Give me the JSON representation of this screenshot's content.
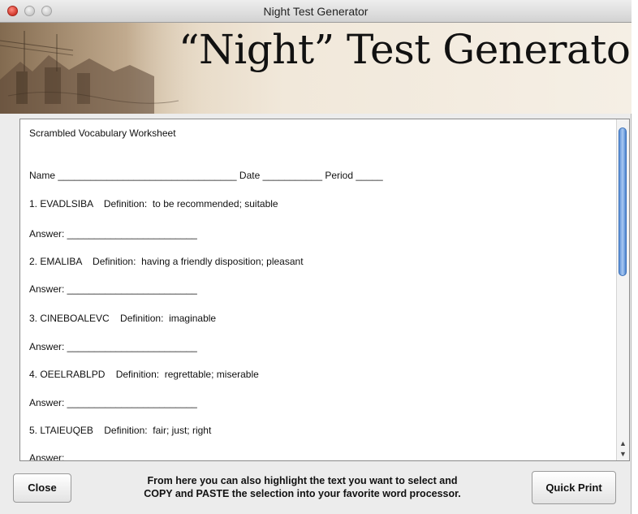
{
  "window": {
    "title": "Night Test Generator"
  },
  "banner": {
    "title": "“Night” Test Generator"
  },
  "document": {
    "lines": [
      "Scrambled Vocabulary Worksheet",
      "Name _________________________________ Date ___________ Period _____",
      "1. EVADLSIBA    Definition:  to be recommended; suitable",
      "Answer: ________________________",
      "2. EMALIBA    Definition:  having a friendly disposition; pleasant",
      "Answer: ________________________",
      "3. CINEBOALEVC    Definition:  imaginable",
      "Answer: ________________________",
      "4. OEELRABLPD    Definition:  regrettable; miserable",
      "Answer: ________________________",
      "5. LTAIEUQEB    Definition:  fair; just; right",
      "Answer:"
    ]
  },
  "footer": {
    "close_label": "Close",
    "message_line1": "From here you can also highlight the text you want to select and",
    "message_line2": "COPY and PASTE the selection into your favorite word processor.",
    "print_label": "Quick Print"
  },
  "icons": {
    "scroll_up": "scroll-up-arrow-icon",
    "scroll_down": "scroll-down-arrow-icon"
  },
  "colors": {
    "close_light": "#e0443a",
    "scroll_thumb": "#5a8fd6",
    "banner_bg": "#f1e8da"
  }
}
